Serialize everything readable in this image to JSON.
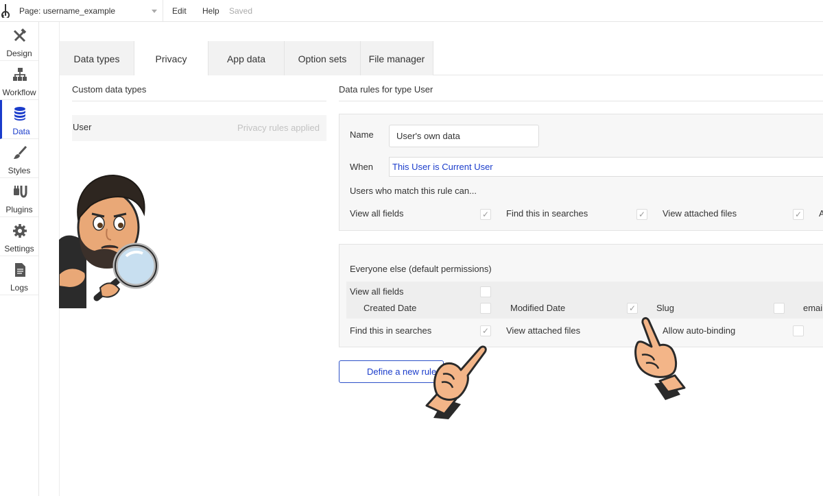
{
  "topbar": {
    "logo_letter": "b",
    "page_selector": "Page: username_example",
    "menu": [
      "Edit",
      "Help"
    ],
    "status": "Saved"
  },
  "sidebar": {
    "items": [
      {
        "label": "Design",
        "icon": "design-icon"
      },
      {
        "label": "Workflow",
        "icon": "workflow-icon"
      },
      {
        "label": "Data",
        "icon": "database-icon",
        "active": true
      },
      {
        "label": "Styles",
        "icon": "brush-icon"
      },
      {
        "label": "Plugins",
        "icon": "plug-icon"
      },
      {
        "label": "Settings",
        "icon": "gear-icon"
      },
      {
        "label": "Logs",
        "icon": "document-icon"
      }
    ]
  },
  "tabs": [
    "Data types",
    "Privacy",
    "App data",
    "Option sets",
    "File manager"
  ],
  "active_tab": "Privacy",
  "left": {
    "title": "Custom data types",
    "types": [
      {
        "name": "User",
        "note": "Privacy rules applied"
      }
    ]
  },
  "right": {
    "title": "Data rules for type User",
    "rule": {
      "name_label": "Name",
      "name_value": "User's own data",
      "when_label": "When",
      "when_value": "This User is Current User",
      "can_label": "Users who match this rule can...",
      "permissions": [
        {
          "label": "View all fields",
          "checked": true
        },
        {
          "label": "Find this in searches",
          "checked": true
        },
        {
          "label": "View attached files",
          "checked": true
        },
        {
          "label": "A",
          "checked": false
        }
      ]
    },
    "everyone": {
      "title": "Everyone else (default permissions)",
      "view_all_fields": {
        "label": "View all fields",
        "checked": false
      },
      "fields": [
        {
          "label": "Created Date",
          "checked": false
        },
        {
          "label": "Modified Date",
          "checked": true
        },
        {
          "label": "Slug",
          "checked": false
        },
        {
          "label": "emai",
          "checked": false
        }
      ],
      "other": [
        {
          "label": "Find this in searches",
          "checked": true
        },
        {
          "label": "View attached files",
          "checked": false
        },
        {
          "label": "Allow auto-binding",
          "checked": false
        }
      ]
    },
    "define_button": "Define a new rule"
  },
  "colors": {
    "accent": "#1a3ccb",
    "panel_bg": "#f7f7f7",
    "tab_bg": "#f2f2f2",
    "skin": "#f3b588"
  },
  "check_glyph": "✓"
}
